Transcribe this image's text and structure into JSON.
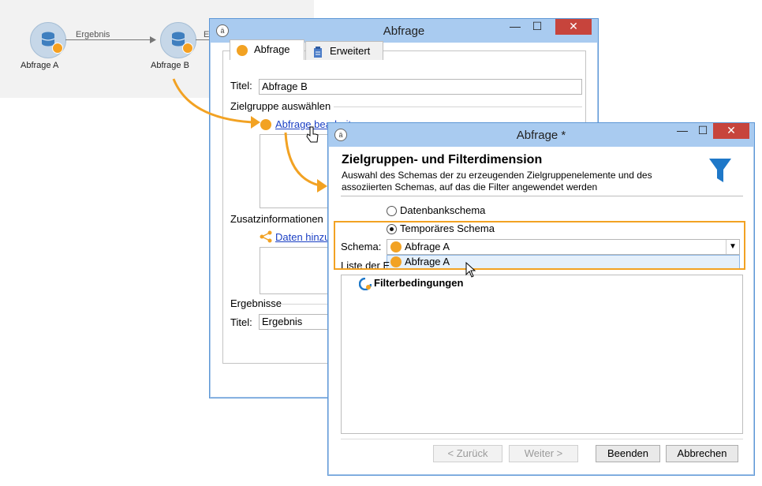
{
  "workflow": {
    "node_a_label": "Abfrage A",
    "node_b_label": "Abfrage B",
    "edge_label": "Ergebnis",
    "edge_label_partial": "E"
  },
  "back_dialog": {
    "title": "Abfrage",
    "tab_query": "Abfrage",
    "tab_advanced": "Erweitert",
    "title_label": "Titel:",
    "title_value": "Abfrage B",
    "targeting_group": "Zielgruppe auswählen",
    "edit_query_link": "Abfrage bearbeiten",
    "additional_info_group": "Zusatzinformationen",
    "add_data_link": "Daten hinzu",
    "results_group": "Ergebnisse",
    "results_title_label": "Titel:",
    "results_title_value": "Ergebnis"
  },
  "front_dialog": {
    "title": "Abfrage *",
    "heading": "Zielgruppen- und Filterdimension",
    "description_line1": "Auswahl des Schemas der zu erzeugenden Zielgruppenelemente und des",
    "description_line2": "assoziierten Schemas, auf das die Filter angewendet werden",
    "radio_db": "Datenbankschema",
    "radio_temp": "Temporäres Schema",
    "schema_label": "Schema:",
    "schema_value": "Abfrage A",
    "dropdown_option": "Abfrage A",
    "list_label_partial": "Liste der E",
    "filter_conditions": "Filterbedingungen",
    "btn_back": "< Zurück",
    "btn_next": "Weiter >",
    "btn_finish": "Beenden",
    "btn_cancel": "Abbrechen"
  },
  "colors": {
    "accent_orange": "#f2a223",
    "titlebar": "#a9cbf0",
    "close_red": "#c7443c",
    "link_blue": "#1a3fc4"
  }
}
